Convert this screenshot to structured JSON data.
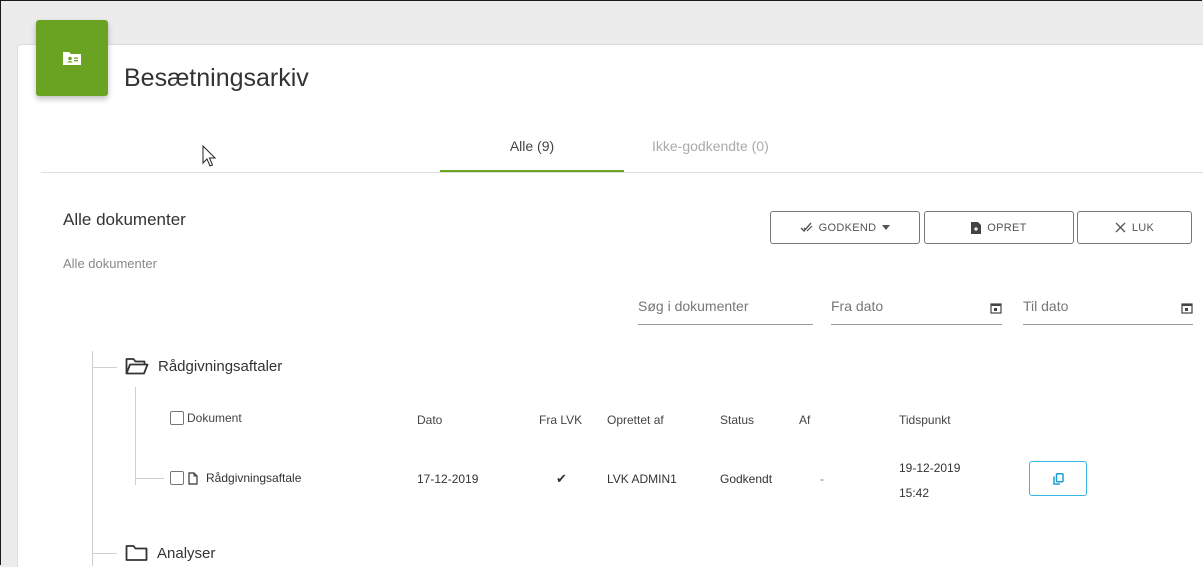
{
  "app": {
    "title": "Besætningsarkiv",
    "badge_icon": "contact-folder-icon",
    "accent_color": "#6aa322"
  },
  "tabs": [
    {
      "label": "Alle (9)",
      "active": true
    },
    {
      "label": "Ikke-godkendte (0)",
      "active": false
    }
  ],
  "section": {
    "title": "Alle dokumenter",
    "subtitle": "Alle dokumenter"
  },
  "toolbar": {
    "approve_label": "GODKEND",
    "create_label": "OPRET",
    "close_label": "LUK"
  },
  "filters": {
    "search_placeholder": "Søg i dokumenter",
    "from_placeholder": "Fra dato",
    "to_placeholder": "Til dato"
  },
  "tree": {
    "folders": [
      {
        "name": "Rådgivningsaftaler",
        "open": true
      },
      {
        "name": "Analyser",
        "open": false
      }
    ]
  },
  "table": {
    "columns": [
      "Dokument",
      "Dato",
      "Fra LVK",
      "Oprettet af",
      "Status",
      "Af",
      "Tidspunkt"
    ],
    "rows": [
      {
        "document": "Rådgivningsaftale",
        "date": "17-12-2019",
        "from_lvk": "✔",
        "created_by": "LVK ADMIN1",
        "status": "Godkendt",
        "by": "-",
        "time_date": "19-12-2019",
        "time_clock": "15:42"
      }
    ]
  },
  "colors": {
    "copy_button_border": "#37b6e6"
  }
}
